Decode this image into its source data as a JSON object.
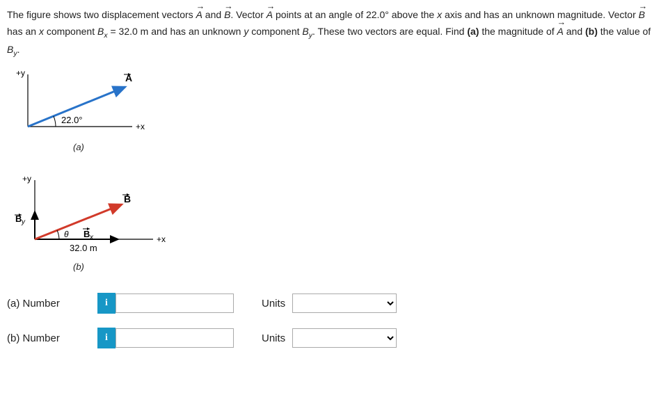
{
  "problem": {
    "sentence1_a": "The figure shows two displacement vectors ",
    "vecA": "A",
    "and": " and ",
    "vecB": "B",
    "sentence1_b": ". Vector ",
    "sentence1_c": " points at an angle of 22.0° above the ",
    "xaxis": "x",
    "sentence1_d": " axis and has an unknown magnitude. Vector ",
    "sentence1_e": " has an ",
    "sentence1_f": " component ",
    "Bx": "Bₓ",
    "eq": " = 32.0 m and has an unknown ",
    "y": "y",
    "sentence1_g": " component ",
    "By": "By",
    "sentence1_h": ". These two vectors are equal. Find ",
    "bold_a": "(a)",
    "sentence1_i": " the magnitude of ",
    "sentence1_j": " and ",
    "bold_b": "(b)",
    "sentence1_k": " the value of ",
    "sentence1_l": "."
  },
  "figure": {
    "a": {
      "plus_y": "+y",
      "plus_x": "+x",
      "angle": "22.0°",
      "vec_label": "A",
      "caption": "(a)"
    },
    "b": {
      "plus_y": "+y",
      "plus_x": "+x",
      "By_label": "By",
      "theta": "θ",
      "Bx_label": "Bₓ",
      "length": "32.0 m",
      "vec_label": "B",
      "caption": "(b)"
    }
  },
  "answers": {
    "a": {
      "label": "(a)   Number",
      "units_label": "Units",
      "info": "i"
    },
    "b": {
      "label": "(b)   Number",
      "units_label": "Units",
      "info": "i"
    }
  }
}
